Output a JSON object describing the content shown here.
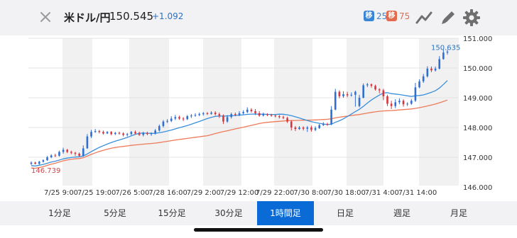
{
  "header": {
    "pair": "米ドル/円",
    "price": "150.545",
    "change": "+1.092",
    "buy_badge": "移",
    "buy_count": "25",
    "sell_badge": "移",
    "sell_count": "75",
    "icons": [
      "close-icon",
      "trend-icon",
      "pencil-icon",
      "gear-icon"
    ],
    "colors": {
      "buy": "#3a86d6",
      "sell": "#e46a4e",
      "change": "#2a72c0"
    }
  },
  "chart_data": {
    "type": "candlestick",
    "y_ticks": [
      "151.000",
      "150.000",
      "149.000",
      "148.000",
      "147.000",
      "146.000"
    ],
    "ylim": [
      146.0,
      151.0
    ],
    "x_labels": [
      "7/25 9:00",
      "7/25 19:00",
      "7/26 5:00",
      "7/28 16:00",
      "7/29 2:00",
      "7/29 12:00",
      "7/29 22:00",
      "7/30 8:00",
      "7/30 18:00",
      "7/31 4:00",
      "7/31 14:00"
    ],
    "low_label": "146.739",
    "high_label": "150.635",
    "colors": {
      "up": "#2e6fd1",
      "down": "#d8343d",
      "ma_short": "#3a8fdc",
      "ma_long": "#ef7a5a"
    },
    "candles": [
      [
        146.78,
        146.82,
        146.74,
        146.86
      ],
      [
        146.82,
        146.78,
        146.76,
        146.85
      ],
      [
        146.78,
        146.85,
        146.75,
        146.88
      ],
      [
        146.85,
        146.9,
        146.82,
        146.93
      ],
      [
        146.9,
        147.0,
        146.88,
        147.04
      ],
      [
        147.0,
        147.06,
        146.97,
        147.1
      ],
      [
        147.06,
        147.05,
        147.01,
        147.12
      ],
      [
        147.05,
        147.18,
        147.02,
        147.22
      ],
      [
        147.18,
        147.25,
        147.12,
        147.32
      ],
      [
        147.25,
        147.18,
        147.14,
        147.28
      ],
      [
        147.18,
        147.15,
        147.1,
        147.22
      ],
      [
        147.15,
        147.12,
        147.05,
        147.18
      ],
      [
        147.12,
        147.05,
        147.0,
        147.16
      ],
      [
        147.05,
        147.3,
        147.02,
        147.4
      ],
      [
        147.3,
        147.7,
        147.28,
        147.78
      ],
      [
        147.7,
        147.85,
        147.65,
        147.92
      ],
      [
        147.85,
        147.88,
        147.82,
        147.95
      ],
      [
        147.88,
        147.85,
        147.8,
        147.92
      ],
      [
        147.85,
        147.8,
        147.76,
        147.9
      ],
      [
        147.8,
        147.85,
        147.78,
        147.88
      ],
      [
        147.85,
        147.78,
        147.74,
        147.88
      ],
      [
        147.78,
        147.82,
        147.75,
        147.85
      ],
      [
        147.82,
        147.8,
        147.76,
        147.86
      ],
      [
        147.8,
        147.75,
        147.7,
        147.84
      ],
      [
        147.75,
        147.78,
        147.7,
        147.82
      ],
      [
        147.78,
        147.85,
        147.74,
        147.88
      ],
      [
        147.85,
        147.8,
        147.77,
        147.9
      ],
      [
        147.8,
        147.75,
        147.72,
        147.86
      ],
      [
        147.75,
        147.82,
        147.7,
        147.86
      ],
      [
        147.82,
        147.78,
        147.74,
        147.86
      ],
      [
        147.78,
        147.8,
        147.72,
        147.84
      ],
      [
        147.8,
        147.9,
        147.76,
        147.95
      ],
      [
        147.9,
        148.05,
        147.86,
        148.1
      ],
      [
        148.05,
        148.2,
        148.0,
        148.25
      ],
      [
        148.2,
        148.22,
        148.15,
        148.28
      ],
      [
        148.22,
        148.3,
        148.18,
        148.38
      ],
      [
        148.3,
        148.35,
        148.25,
        148.42
      ],
      [
        148.35,
        148.3,
        148.26,
        148.4
      ],
      [
        148.3,
        148.28,
        148.22,
        148.35
      ],
      [
        148.28,
        148.38,
        148.25,
        148.42
      ],
      [
        148.38,
        148.4,
        148.32,
        148.45
      ],
      [
        148.4,
        148.42,
        148.36,
        148.48
      ],
      [
        148.42,
        148.45,
        148.38,
        148.5
      ],
      [
        148.45,
        148.48,
        148.4,
        148.52
      ],
      [
        148.48,
        148.46,
        148.42,
        148.52
      ],
      [
        148.46,
        148.5,
        148.43,
        148.55
      ],
      [
        148.5,
        148.45,
        148.4,
        148.55
      ],
      [
        148.45,
        148.4,
        148.32,
        148.5
      ],
      [
        148.4,
        148.2,
        148.12,
        148.44
      ],
      [
        148.2,
        148.35,
        148.16,
        148.42
      ],
      [
        148.35,
        148.45,
        148.3,
        148.5
      ],
      [
        148.45,
        148.42,
        148.38,
        148.5
      ],
      [
        148.42,
        148.48,
        148.38,
        148.55
      ],
      [
        148.48,
        148.52,
        148.44,
        148.58
      ],
      [
        148.52,
        148.6,
        148.48,
        148.68
      ],
      [
        148.6,
        148.55,
        148.5,
        148.65
      ],
      [
        148.55,
        148.48,
        148.42,
        148.62
      ],
      [
        148.48,
        148.4,
        148.36,
        148.55
      ],
      [
        148.4,
        148.45,
        148.37,
        148.5
      ],
      [
        148.45,
        148.42,
        148.38,
        148.48
      ],
      [
        148.42,
        148.4,
        148.36,
        148.46
      ],
      [
        148.4,
        148.38,
        148.34,
        148.44
      ],
      [
        148.38,
        148.35,
        148.3,
        148.42
      ],
      [
        148.35,
        148.32,
        148.28,
        148.4
      ],
      [
        148.32,
        148.2,
        148.15,
        148.36
      ],
      [
        148.2,
        148.0,
        147.9,
        148.24
      ],
      [
        148.0,
        147.95,
        147.88,
        148.05
      ],
      [
        147.95,
        148.0,
        147.92,
        148.05
      ],
      [
        148.0,
        147.96,
        147.9,
        148.04
      ],
      [
        147.96,
        148.0,
        147.85,
        148.05
      ],
      [
        148.0,
        147.92,
        147.86,
        148.06
      ],
      [
        147.92,
        147.98,
        147.88,
        148.04
      ],
      [
        147.98,
        148.08,
        147.95,
        148.12
      ],
      [
        148.08,
        148.12,
        148.05,
        148.18
      ],
      [
        148.12,
        148.1,
        148.06,
        148.16
      ],
      [
        148.1,
        148.6,
        148.08,
        148.72
      ],
      [
        148.6,
        149.2,
        148.58,
        149.3
      ],
      [
        149.2,
        149.05,
        148.98,
        149.25
      ],
      [
        149.05,
        149.12,
        149.0,
        149.22
      ],
      [
        149.12,
        149.08,
        149.02,
        149.2
      ],
      [
        149.08,
        149.1,
        149.04,
        149.18
      ],
      [
        149.1,
        149.2,
        148.7,
        149.24
      ],
      [
        148.72,
        149.0,
        148.68,
        149.1
      ],
      [
        149.0,
        149.42,
        148.98,
        149.48
      ],
      [
        149.42,
        149.45,
        149.36,
        149.5
      ],
      [
        149.45,
        149.4,
        149.34,
        149.48
      ],
      [
        149.4,
        149.28,
        149.24,
        149.44
      ],
      [
        149.28,
        149.25,
        149.15,
        149.32
      ],
      [
        149.25,
        149.05,
        148.92,
        149.3
      ],
      [
        149.05,
        148.8,
        148.72,
        149.1
      ],
      [
        148.8,
        148.72,
        148.62,
        148.9
      ],
      [
        148.72,
        148.85,
        148.65,
        148.95
      ],
      [
        148.85,
        148.9,
        148.78,
        148.98
      ],
      [
        148.9,
        148.78,
        148.7,
        148.95
      ],
      [
        148.78,
        148.8,
        148.72,
        148.85
      ],
      [
        148.8,
        148.9,
        148.76,
        148.96
      ],
      [
        148.9,
        149.35,
        148.86,
        149.5
      ],
      [
        149.35,
        149.55,
        149.32,
        149.62
      ],
      [
        149.55,
        149.72,
        149.5,
        149.8
      ],
      [
        149.72,
        149.98,
        149.68,
        150.06
      ],
      [
        149.98,
        149.92,
        149.86,
        150.05
      ],
      [
        149.92,
        149.98,
        149.88,
        150.05
      ],
      [
        149.98,
        150.3,
        149.95,
        150.4
      ],
      [
        150.3,
        150.52,
        150.28,
        150.62
      ],
      [
        150.52,
        150.55,
        150.45,
        150.62
      ]
    ]
  },
  "tabs": [
    {
      "label": "1分足",
      "active": false
    },
    {
      "label": "5分足",
      "active": false
    },
    {
      "label": "15分足",
      "active": false
    },
    {
      "label": "30分足",
      "active": false
    },
    {
      "label": "1時間足",
      "active": true
    },
    {
      "label": "日足",
      "active": false
    },
    {
      "label": "週足",
      "active": false
    },
    {
      "label": "月足",
      "active": false
    }
  ]
}
